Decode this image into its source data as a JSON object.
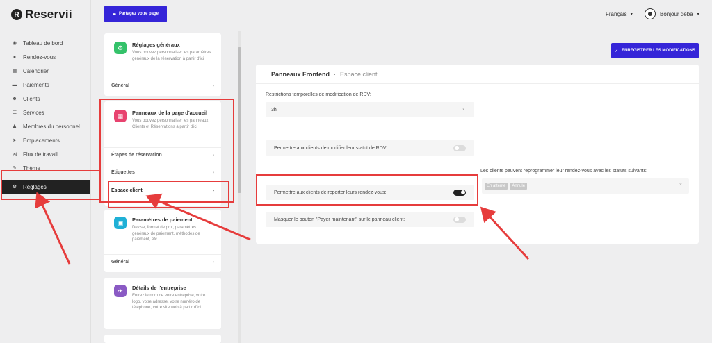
{
  "app": {
    "name": "Reservii",
    "logo_letter": "R"
  },
  "sidebar": {
    "items": [
      {
        "label": "Tableau de bord",
        "icon": "dashboard-icon",
        "glyph": "◉"
      },
      {
        "label": "Rendez-vous",
        "icon": "clock-icon",
        "glyph": "●"
      },
      {
        "label": "Calendrier",
        "icon": "calendar-icon",
        "glyph": "▦"
      },
      {
        "label": "Paiements",
        "icon": "payment-icon",
        "glyph": "▬"
      },
      {
        "label": "Clients",
        "icon": "users-icon",
        "glyph": "☻"
      },
      {
        "label": "Services",
        "icon": "list-icon",
        "glyph": "☰"
      },
      {
        "label": "Membres du personnel",
        "icon": "person-icon",
        "glyph": "♟"
      },
      {
        "label": "Emplacements",
        "icon": "location-icon",
        "glyph": "➤"
      },
      {
        "label": "Flux de travail",
        "icon": "workflow-icon",
        "glyph": "⋈"
      },
      {
        "label": "Thème",
        "icon": "brush-icon",
        "glyph": "✎"
      },
      {
        "label": "Réglages",
        "icon": "gear-icon",
        "glyph": "⚙",
        "active": true
      }
    ]
  },
  "topbar": {
    "share_label": "Partagez votre page",
    "language": "Français",
    "user_greeting": "Bonjour deba"
  },
  "settings_cards": {
    "general": {
      "title": "Réglages généraux",
      "desc": "Vous pouvez personnaliser les paramètres généraux de la réservation à partir d'ici",
      "rows": [
        "Général"
      ]
    },
    "home_panels": {
      "title": "Panneaux de la page d'accueil",
      "desc": "Vous pouvez personnaliser les panneaux Clients et Réservations à partir d'ici",
      "rows": [
        "Étapes de réservation",
        "Étiquettes",
        "Espace client"
      ]
    },
    "payment": {
      "title": "Paramètres de paiement",
      "desc": "Devise, format de prix, paramètres généraux de paiement, méthodes de paiement, etc",
      "rows": [
        "Général"
      ]
    },
    "company": {
      "title": "Détails de l'entreprise",
      "desc": "Entrez le nom de votre entreprise, votre logo, votre adresse, votre numéro de téléphone, votre site web à partir d'ici"
    }
  },
  "main": {
    "save_label": "ENREGISTRER LES MODIFICATIONS",
    "breadcrumb_title": "Panneaux Frontend",
    "breadcrumb_sub": "Espace client",
    "restriction_label": "Restrictions temporelles de modification de RDV:",
    "restriction_value": "3h",
    "toggle_status_label": "Permettre aux clients de modifier leur statut de RDV:",
    "toggle_status_on": false,
    "toggle_reschedule_label": "Permettre aux clients de reporter leurs rendez-vous:",
    "toggle_reschedule_on": true,
    "toggle_pay_label": "Masquer le bouton \"Payer maintenant\" sur le panneau client:",
    "toggle_pay_on": false,
    "reschedule_statuses_label": "Les clients peuvent reprogrammer leur rendez-vous avec les statuts suivants:",
    "reschedule_statuses": [
      "En attente",
      "Annulé"
    ]
  },
  "colors": {
    "accent": "#3525d8",
    "annotation": "#e63c3c",
    "sidebar_active": "#222222"
  }
}
